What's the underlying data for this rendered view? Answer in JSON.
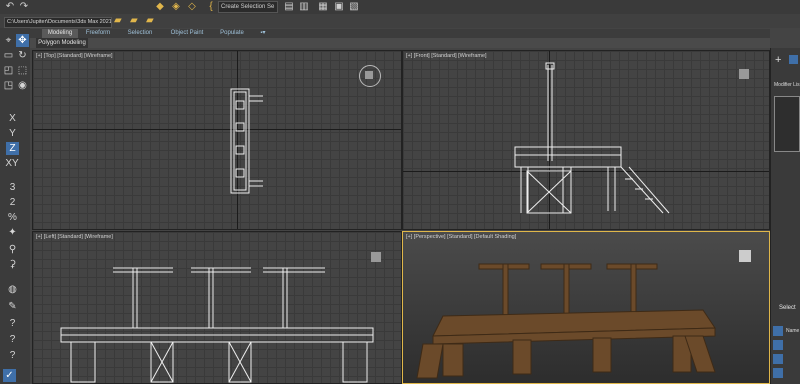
{
  "toolbar": {
    "undo_icon": "undo-icon",
    "redo_icon": "redo-icon",
    "selection_set_placeholder": "Create Selection Se"
  },
  "path_bar": {
    "project_path": "C:\\Users\\Jupiter\\Documents\\3ds Max 2021"
  },
  "ribbon": {
    "tabs": [
      "Modeling",
      "Freeform",
      "Selection",
      "Object Paint",
      "Populate"
    ],
    "active_tab": "Modeling",
    "sub_label": "Polygon Modeling"
  },
  "viewports": {
    "top": "[+] [Top] [Standard] [Wireframe]",
    "front": "[+] [Front] [Standard] [Wireframe]",
    "left": "[+] [Left] [Standard] [Wireframe]",
    "perspective": "[+] [Perspective] [Standard] [Default Shading]"
  },
  "left_toolbar": {
    "axis_x": "X",
    "axis_y": "Y",
    "axis_z": "Z",
    "axis_xy": "XY",
    "snap_3": "3",
    "snap_2": "2",
    "percent": "%"
  },
  "command_panel": {
    "modifier_list": "Modifier Lis",
    "select_label": "Select",
    "name_label": "Name"
  },
  "colors": {
    "active_viewport_border": "#e0b74a",
    "selected_button": "#3f6fa8",
    "wood": "#6b4a2a"
  }
}
